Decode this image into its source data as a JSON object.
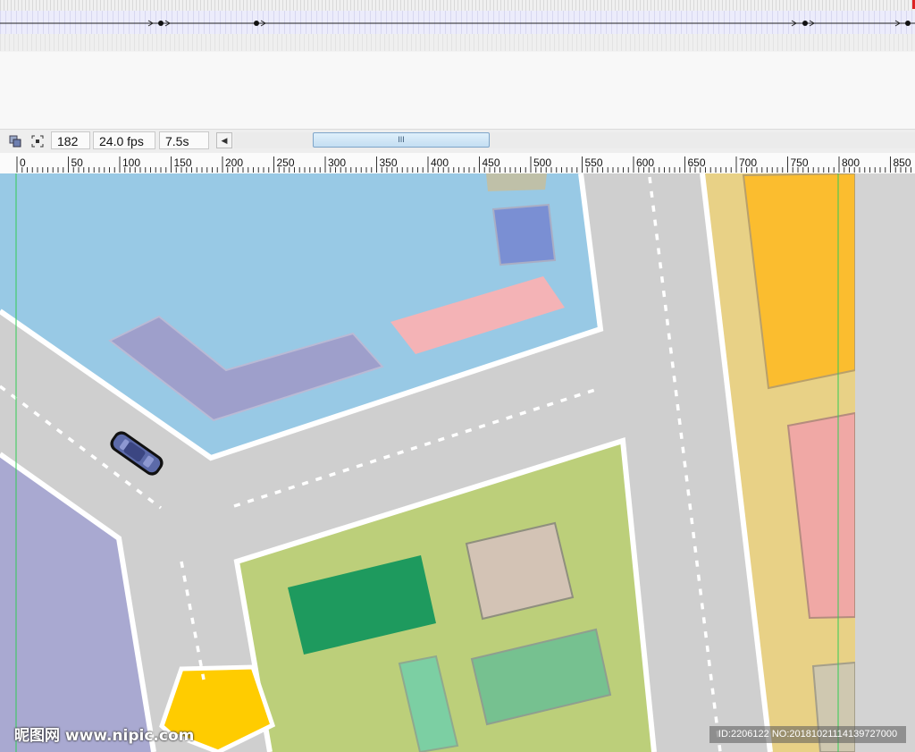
{
  "statusbar": {
    "icon_a": "layers-icon",
    "icon_b": "center-frame-icon",
    "frame": "182",
    "fps": "24.0 fps",
    "time": "7.5s",
    "scroll_left_icon": "left-arrow-icon",
    "scroll_grip": "III"
  },
  "ruler": {
    "labels": [
      "0",
      "50",
      "100",
      "150",
      "200",
      "250",
      "300",
      "350",
      "400",
      "450",
      "500",
      "550",
      "600",
      "650",
      "700",
      "750",
      "800",
      "850"
    ]
  },
  "watermark": {
    "left": "昵图网 www.nipic.com",
    "right": "ID:2206122 NO:20181021114139727000"
  },
  "colors": {
    "water": "#98c9e5",
    "road": "#cfcfcf",
    "park": "#bccf7a",
    "lot_purple": "#a9a9d1",
    "lot_sand": "#e8d186",
    "orange": "#fbbd2f",
    "pink": "#f0a8a5",
    "pentagon": "#ffcc00",
    "car": "#5c6aa9",
    "guide": "#33cc55"
  }
}
